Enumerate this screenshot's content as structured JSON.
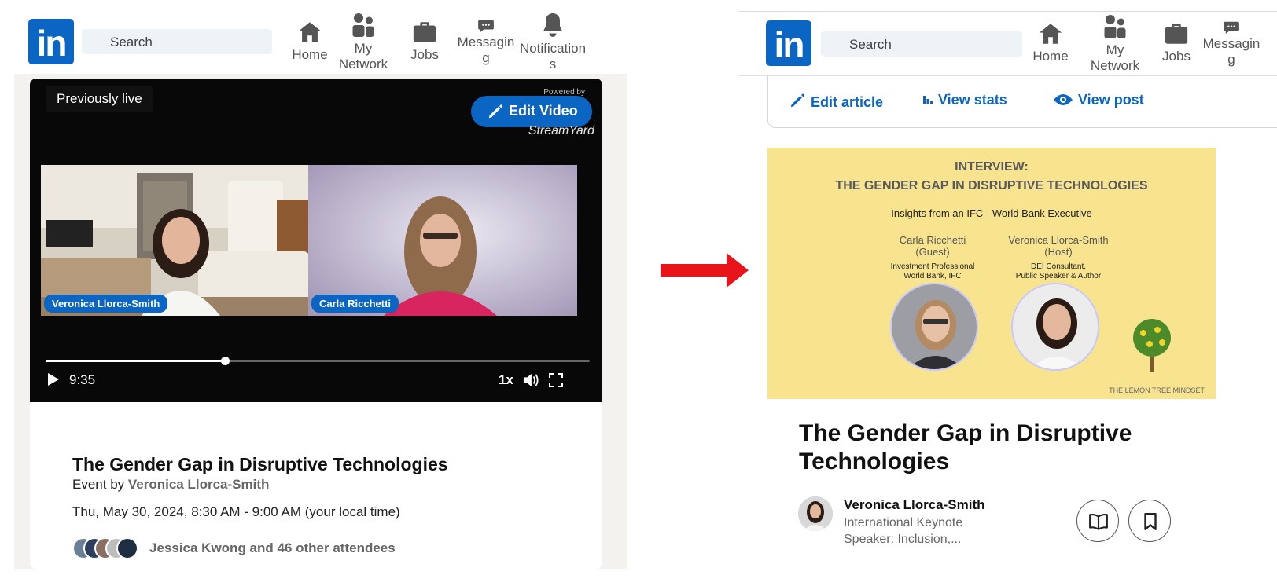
{
  "nav": {
    "logo_text": "in",
    "search_placeholder": "Search",
    "home": "Home",
    "my_network_1": "My",
    "my_network_2": "Network",
    "jobs": "Jobs",
    "messaging_1": "Messagin",
    "messaging_2": "g",
    "notifications_1": "Notification",
    "notifications_2": "s"
  },
  "video": {
    "live_badge": "Previously live",
    "powered_by": "Powered by",
    "edit_button": "Edit Video",
    "brand": "StreamYard",
    "participant_left": "Veronica Llorca-Smith",
    "participant_right": "Carla Ricchetti",
    "time": "9:35",
    "speed": "1x",
    "progress_fraction": 0.33
  },
  "event": {
    "title": "The Gender Gap in Disruptive Technologies",
    "by_prefix": "Event by",
    "host": "Veronica Llorca-Smith",
    "date": "Thu, May 30, 2024, 8:30 AM - 9:00 AM (your local time)",
    "attendees": "Jessica Kwong and 46 other attendees"
  },
  "article": {
    "actions": {
      "edit": "Edit article",
      "stats": "View stats",
      "post": "View post"
    },
    "banner": {
      "line1": "INTERVIEW:",
      "line2": "THE GENDER GAP IN DISRUPTIVE TECHNOLOGIES",
      "line3": "Insights from an IFC - World Bank Executive",
      "guest_name": "Carla Ricchetti",
      "guest_role": "(Guest)",
      "guest_desc_1": "Investment Professional",
      "guest_desc_2": "World Bank, IFC",
      "host_name": "Veronica Llorca-Smith",
      "host_role": "(Host)",
      "host_desc_1": "DEI Consultant,",
      "host_desc_2": "Public Speaker & Author",
      "brand": "THE LEMON TREE MINDSET"
    },
    "title": "The Gender Gap in Disruptive Technologies",
    "author_name": "Veronica Llorca-Smith",
    "author_sub_1": "International Keynote",
    "author_sub_2": "Speaker: Inclusion,..."
  },
  "colors": {
    "linkedin_blue": "#0a66c2",
    "arrow_red": "#e8141a",
    "banner_yellow": "#f8e48f"
  }
}
